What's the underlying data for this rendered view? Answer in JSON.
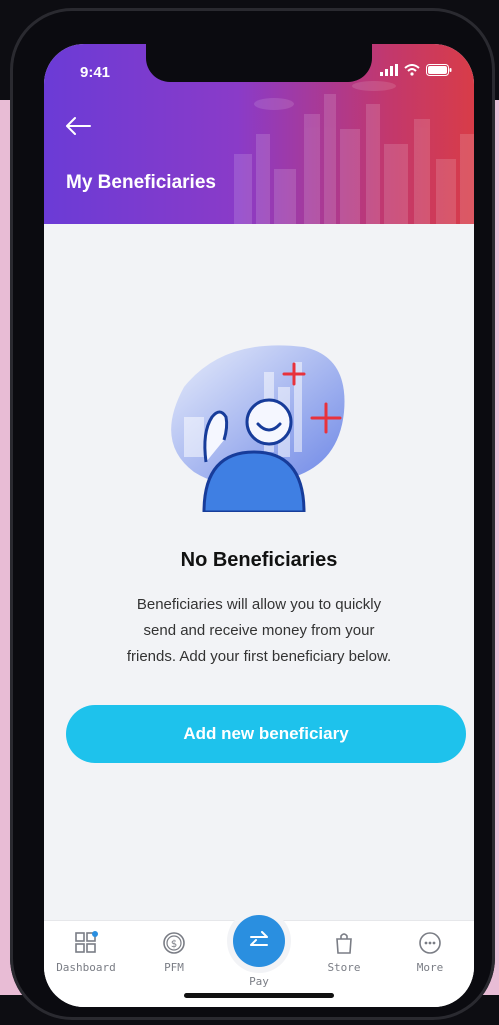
{
  "status_bar": {
    "time": "9:41"
  },
  "header": {
    "title": "My Beneficiaries"
  },
  "empty_state": {
    "title": "No Beneficiaries",
    "description_lines": [
      "Beneficiaries will allow you to quickly",
      "send and receive money from your",
      "friends. Add your first beneficiary below."
    ]
  },
  "actions": {
    "add_label": "Add new beneficiary"
  },
  "tabbar": {
    "items": [
      {
        "label": "Dashboard",
        "icon": "dashboard-icon"
      },
      {
        "label": "PFM",
        "icon": "dollar-coin-icon"
      },
      {
        "label": "Pay",
        "icon": "transfer-arrows-icon"
      },
      {
        "label": "Store",
        "icon": "shopping-bag-icon"
      },
      {
        "label": "More",
        "icon": "more-dots-icon"
      }
    ]
  },
  "colors": {
    "header_start": "#6b3bd6",
    "header_end": "#d83c48",
    "accent": "#1ec2ec",
    "pay_button": "#2a8fe0",
    "plus_red": "#e8323c"
  }
}
